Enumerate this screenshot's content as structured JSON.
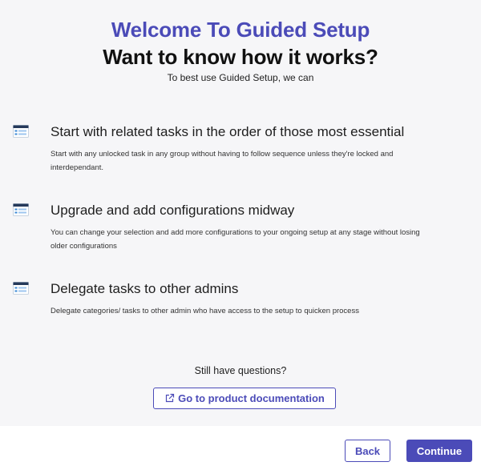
{
  "header": {
    "title": "Welcome To Guided Setup",
    "subtitle": "Want to know how it works?",
    "lead": "To best use Guided Setup, we can"
  },
  "features": [
    {
      "icon": "window-list-icon",
      "title": "Start with related tasks in the order of those most essential",
      "description": "Start with any unlocked task in any group without having to follow sequence unless they're locked and interdependant."
    },
    {
      "icon": "window-list-icon",
      "title": "Upgrade and add configurations midway",
      "description": "You can change your selection and add more configurations to your ongoing setup at any stage without losing older configurations"
    },
    {
      "icon": "window-list-icon",
      "title": "Delegate tasks to other admins",
      "description": "Delegate categories/ tasks to other admin who have access to the setup to quicken process"
    }
  ],
  "help": {
    "question": "Still have questions?",
    "doc_link_label": "Go to product documentation",
    "doc_link_icon": "external-link-icon"
  },
  "footer": {
    "back_label": "Back",
    "continue_label": "Continue"
  },
  "colors": {
    "accent": "#4b4bb8",
    "background": "#f6f6f8",
    "icon_dark": "#25395a",
    "icon_blue": "#3c8ad6"
  }
}
